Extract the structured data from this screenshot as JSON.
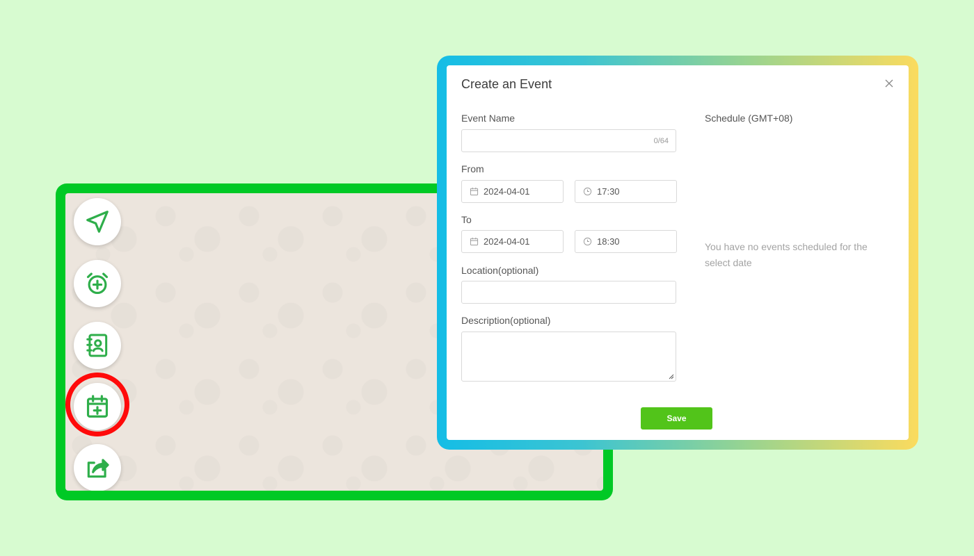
{
  "chat_toolbar": {
    "icons": [
      "send-icon",
      "alarm-add-icon",
      "contact-book-icon",
      "calendar-add-icon",
      "share-icon"
    ],
    "highlighted": "calendar-add-icon",
    "accent": "#2eae4a"
  },
  "modal": {
    "title": "Create an Event",
    "event_name": {
      "label": "Event Name",
      "value": "",
      "counter": "0/64"
    },
    "from": {
      "label": "From",
      "date": "2024-04-01",
      "time": "17:30"
    },
    "to": {
      "label": "To",
      "date": "2024-04-01",
      "time": "18:30"
    },
    "location": {
      "label": "Location(optional)",
      "value": ""
    },
    "description": {
      "label": "Description(optional)",
      "value": ""
    },
    "schedule": {
      "title": "Schedule (GMT+08)",
      "empty_message": "You have no events scheduled for the select date"
    },
    "save_label": "Save"
  },
  "colors": {
    "background": "#d7fbd0",
    "chat_frame": "#00c925",
    "highlight_ring": "#ff0a0a",
    "save_button": "#52c41a"
  }
}
